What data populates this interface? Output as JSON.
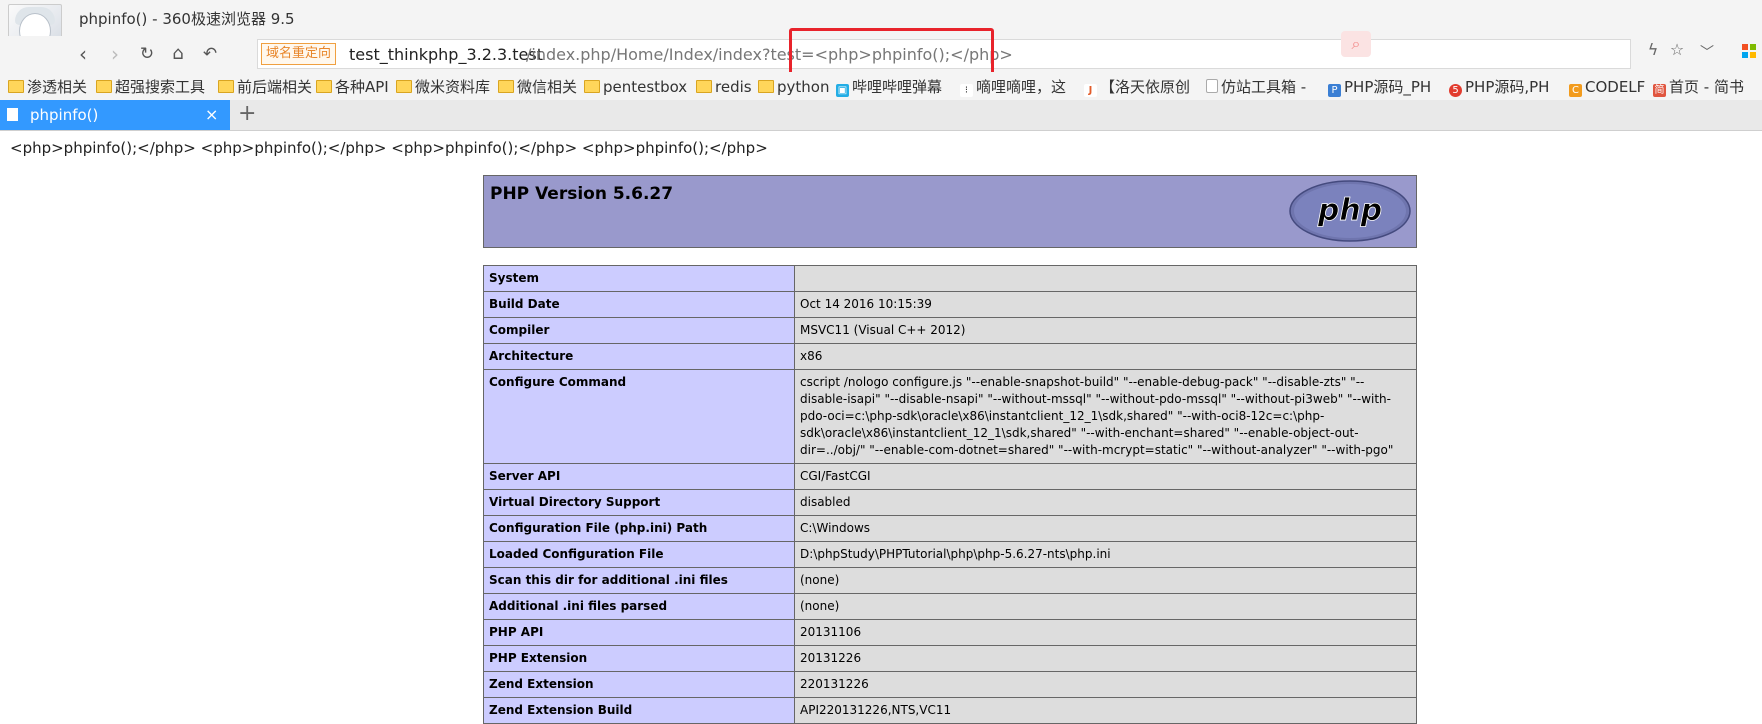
{
  "window": {
    "title": "phpinfo() - 360极速浏览器 9.5"
  },
  "address_bar": {
    "redirect_badge": "域名重定向",
    "url_host": "test_thinkphp_3.2.3.test",
    "url_path": "/index.php/Home/Index/index?test=<php>phpinfo();</php>",
    "icons": [
      "lightning-icon",
      "star-icon"
    ]
  },
  "bookmarks": [
    {
      "label": "渗透相关",
      "icon": "folder-icon"
    },
    {
      "label": "超强搜索工具",
      "icon": "folder-icon"
    },
    {
      "label": "前后端相关",
      "icon": "folder-icon"
    },
    {
      "label": "各种API",
      "icon": "folder-icon"
    },
    {
      "label": "微米资料库",
      "icon": "folder-icon"
    },
    {
      "label": "微信相关",
      "icon": "folder-icon"
    },
    {
      "label": "pentestbox",
      "icon": "folder-icon"
    },
    {
      "label": "redis",
      "icon": "folder-icon"
    },
    {
      "label": "python",
      "icon": "folder-icon"
    },
    {
      "label": "哔哩哔哩弹幕",
      "icon": "bilibili-icon"
    },
    {
      "label": "嘀哩嘀哩，这",
      "icon": "site-icon"
    },
    {
      "label": "【洛天依原创",
      "icon": "site-icon"
    },
    {
      "label": "仿站工具箱 -",
      "icon": "page-icon"
    },
    {
      "label": "PHP源码_PH",
      "icon": "site-icon"
    },
    {
      "label": "PHP源码,PH",
      "icon": "site-icon"
    },
    {
      "label": "CODELF",
      "icon": "site-icon"
    },
    {
      "label": "首页 - 简书",
      "icon": "site-icon"
    }
  ],
  "tab": {
    "title": "phpinfo()",
    "close": "×",
    "new_tab": "+"
  },
  "page": {
    "echo_line": "<php>phpinfo();</php> <php>phpinfo();</php> <php>phpinfo();</php> <php>phpinfo();</php>",
    "php_version": "PHP Version 5.6.27",
    "logo_text": "php",
    "rows": [
      [
        "System",
        ""
      ],
      [
        "Build Date",
        "Oct 14 2016 10:15:39"
      ],
      [
        "Compiler",
        "MSVC11 (Visual C++ 2012)"
      ],
      [
        "Architecture",
        "x86"
      ],
      [
        "Configure Command",
        "cscript /nologo configure.js \"--enable-snapshot-build\" \"--enable-debug-pack\" \"--disable-zts\" \"--disable-isapi\" \"--disable-nsapi\" \"--without-mssql\" \"--without-pdo-mssql\" \"--without-pi3web\" \"--with-pdo-oci=c:\\php-sdk\\oracle\\x86\\instantclient_12_1\\sdk,shared\" \"--with-oci8-12c=c:\\php-sdk\\oracle\\x86\\instantclient_12_1\\sdk,shared\" \"--with-enchant=shared\" \"--enable-object-out-dir=../obj/\" \"--enable-com-dotnet=shared\" \"--with-mcrypt=static\" \"--without-analyzer\" \"--with-pgo\""
      ],
      [
        "Server API",
        "CGI/FastCGI"
      ],
      [
        "Virtual Directory Support",
        "disabled"
      ],
      [
        "Configuration File (php.ini) Path",
        "C:\\Windows"
      ],
      [
        "Loaded Configuration File",
        "D:\\phpStudy\\PHPTutorial\\php\\php-5.6.27-nts\\php.ini"
      ],
      [
        "Scan this dir for additional .ini files",
        "(none)"
      ],
      [
        "Additional .ini files parsed",
        "(none)"
      ],
      [
        "PHP API",
        "20131106"
      ],
      [
        "PHP Extension",
        "20131226"
      ],
      [
        "Zend Extension",
        "220131226"
      ],
      [
        "Zend Extension Build",
        "API220131226,NTS,VC11"
      ]
    ]
  },
  "colors": {
    "tab_active": "#3399ff",
    "php_header": "#9999cc",
    "label_cell": "#ccccff",
    "value_cell": "#dddddd",
    "highlight_box": "#e8232b"
  }
}
